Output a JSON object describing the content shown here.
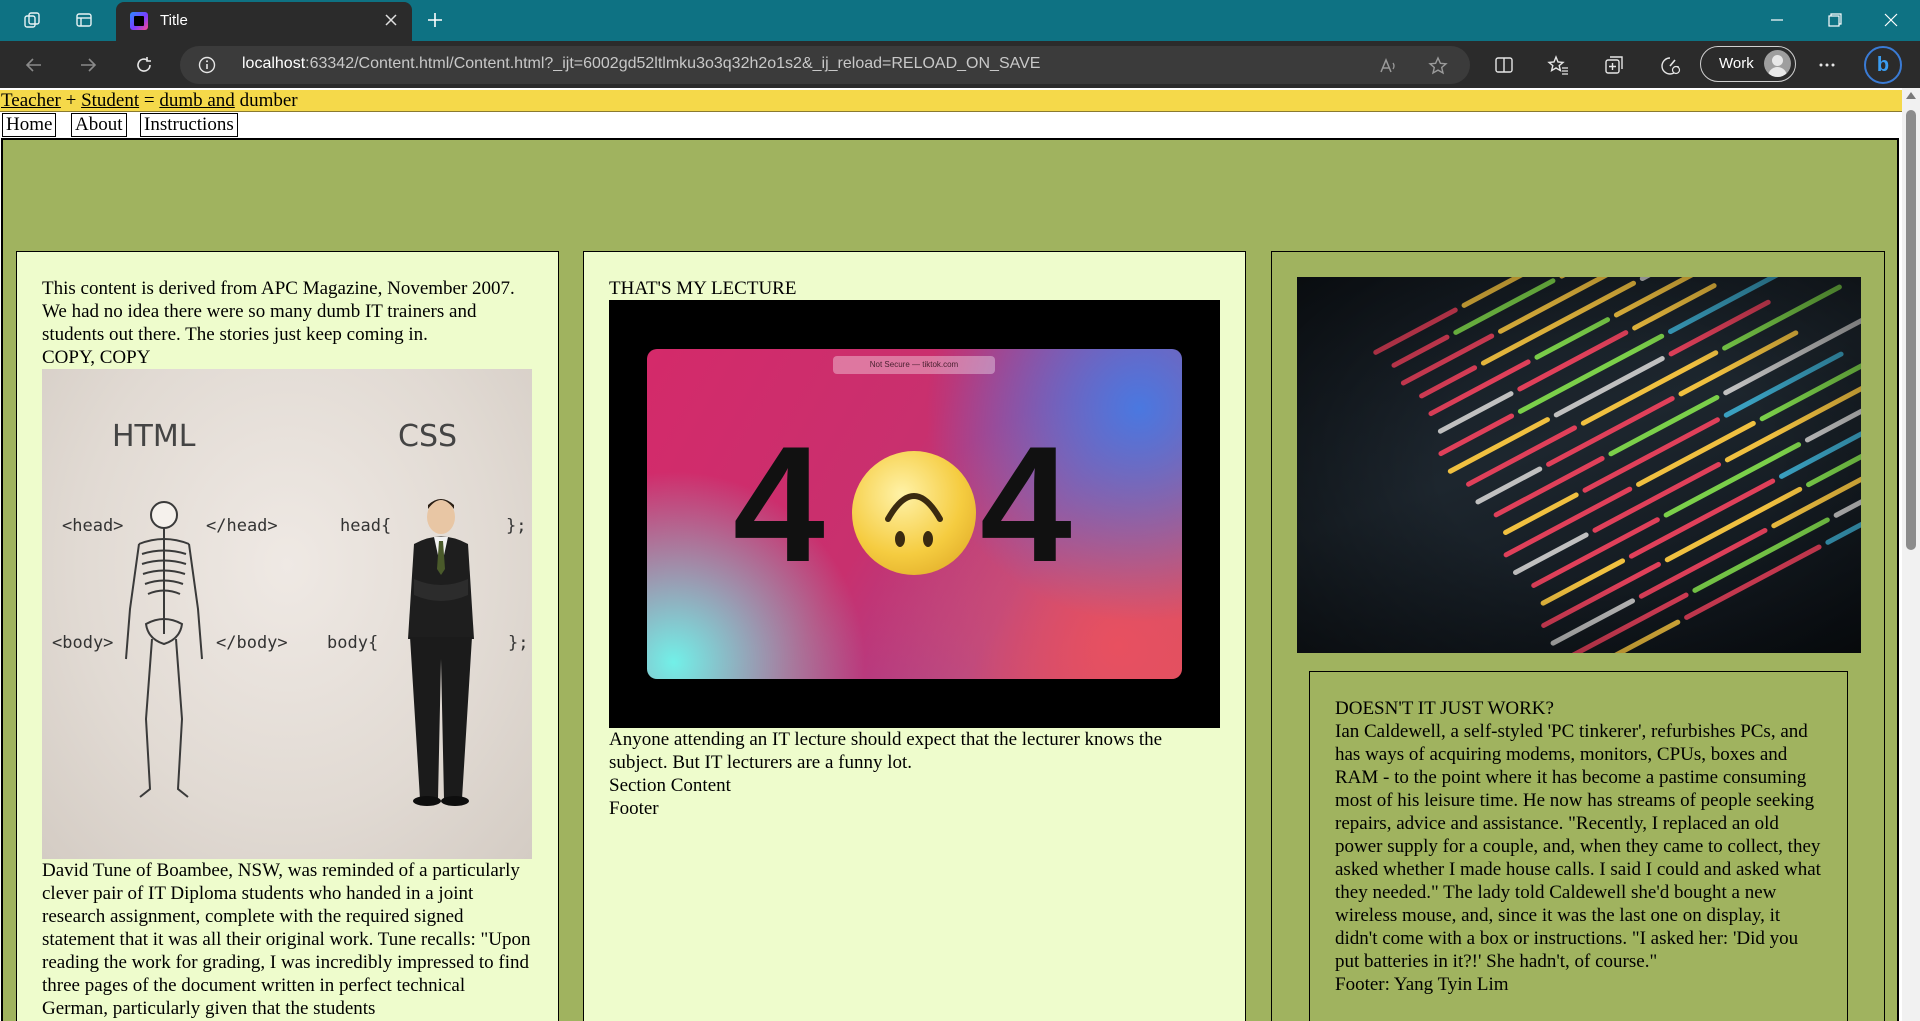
{
  "browser": {
    "tab_title": "Title",
    "url_host": "localhost",
    "url_rest": ":63342/Content.html/Content.html?_ijt=6002gd52ltlmku3o3q32h2o1s2&_ij_reload=RELOAD_ON_SAVE",
    "profile_label": "Work"
  },
  "page": {
    "banner": {
      "link_teacher": "Teacher",
      "link_student": "Student",
      "link_dumb_and": "dumb and",
      "text_1": " + ",
      "text_2": " = ",
      "text_3": " dumber"
    },
    "nav": [
      "Home",
      "About",
      "Instructions"
    ],
    "left": {
      "intro": "This content is derived from APC Magazine, November 2007. We had no idea there were so many dumb IT trainers and students out there. The stories just keep coming in.",
      "heading": "COPY, COPY",
      "image": {
        "html_label": "HTML",
        "css_label": "CSS",
        "head_open": "<head>",
        "head_close": "</head>",
        "css_head": "head{",
        "css_head_end": "};",
        "body_open": "<body>",
        "body_close": "</body>",
        "css_body": "body{",
        "css_body_end": "};"
      },
      "story": "David Tune of Boambee, NSW, was reminded of a particularly clever pair of IT Diploma students who handed in a joint research assignment, complete with the required signed statement that it was all their original work. Tune recalls: \"Upon reading the work for grading, I was incredibly impressed to find three pages of the document written in perfect technical German, particularly given that the students"
    },
    "middle": {
      "heading": "THAT'S MY LECTURE",
      "image": {
        "address": "Not Secure — tiktok.com",
        "digit_left": "4",
        "digit_right": "4"
      },
      "body": "Anyone attending an IT lecture should expect that the lecturer knows the subject. But IT lecturers are a funny lot.",
      "section_content": "Section Content",
      "footer": "Footer"
    },
    "right": {
      "heading": "DOESN'T IT JUST WORK?",
      "body": "Ian Caldewell, a self-styled 'PC tinkerer', refurbishes PCs, and has ways of acquiring modems, monitors, CPUs, boxes and RAM - to the point where it has become a pastime consuming most of his leisure time. He now has streams of people seeking repairs, advice and assistance. \"Recently, I replaced an old power supply for a couple, and, when they came to collect, they asked whether I made house calls. I said I could and asked what they needed.\" The lady told Caldewell she'd bought a new wireless mouse, and, since it was the last one on display, it didn't come with a box or instructions. \"I asked her: 'Did you put batteries in it?!' She hadn't, of course.\"",
      "footer": "Footer: Yang Tyin Lim"
    }
  },
  "colors": {
    "tabbar": "#0e7283",
    "toolbar": "#2b2b2b",
    "banner": "#f5d94a",
    "main_bg": "#a0b35f",
    "card_bg": "#eefccc"
  },
  "icons": {
    "tab_actions": [
      "workspaces-icon",
      "tab-actions-icon"
    ],
    "toolbar": [
      "back-icon",
      "forward-icon",
      "refresh-icon",
      "info-icon",
      "read-aloud-icon",
      "favorite-star-icon",
      "split-screen-icon",
      "favorites-icon",
      "collections-icon",
      "performance-icon",
      "more-icon",
      "bing-copilot-icon"
    ]
  }
}
